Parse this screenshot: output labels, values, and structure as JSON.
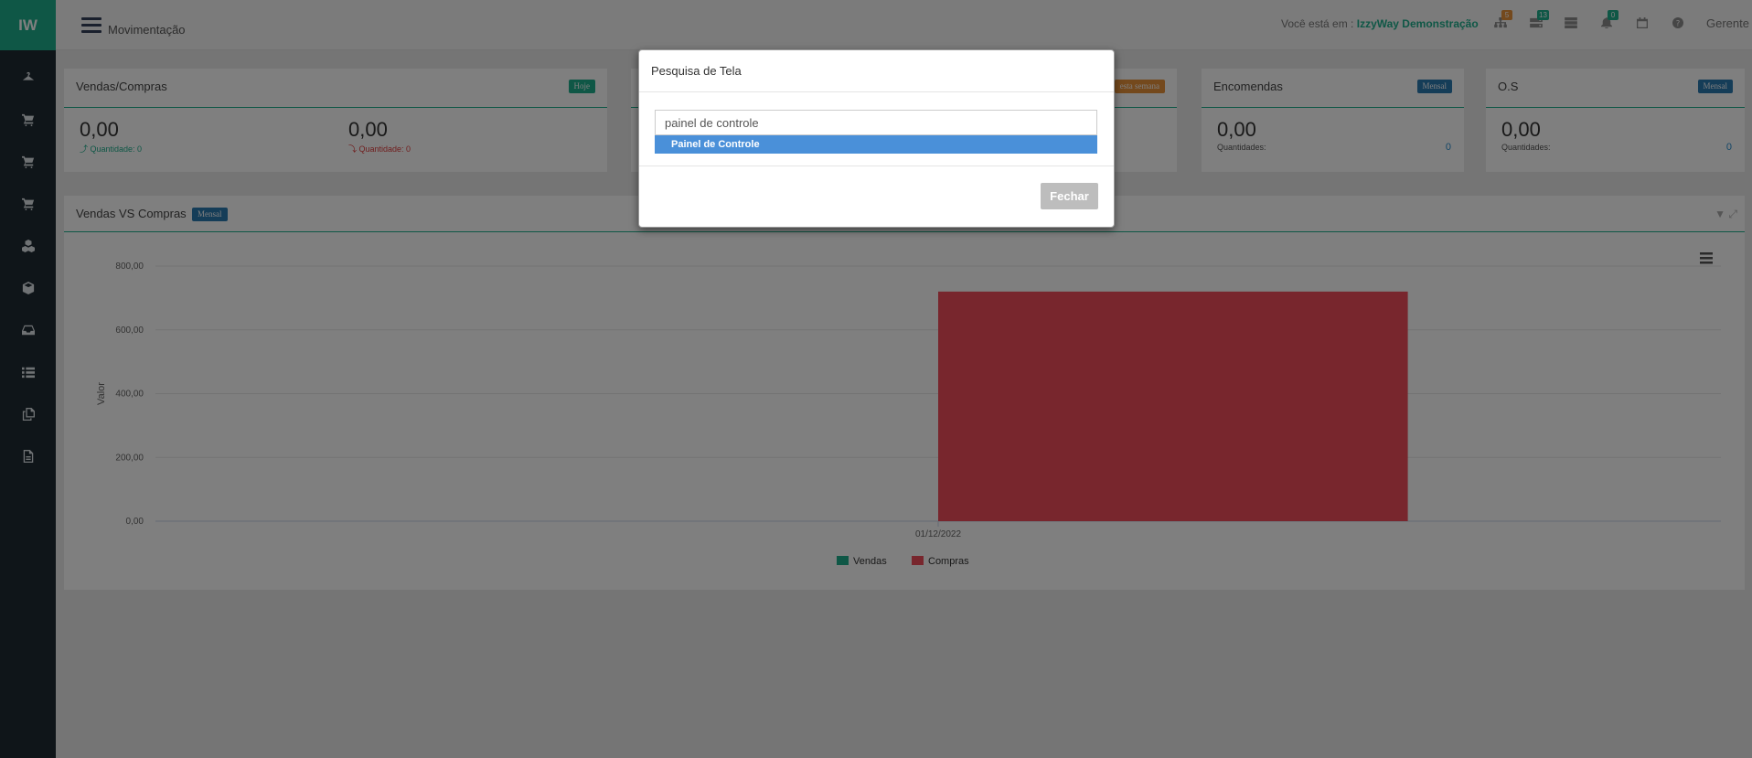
{
  "sidebar": {
    "logo": "IW",
    "items": [
      "hanger-icon",
      "cart-icon",
      "cart-icon",
      "cart-icon",
      "cubes-icon",
      "cube-icon",
      "inbox-icon",
      "list-icon",
      "documents-icon",
      "file-icon"
    ]
  },
  "header": {
    "title": "Movimentação",
    "location_prefix": "Você está em :",
    "location_name": "IzzyWay Demonstração",
    "badges": {
      "sitemap": "5",
      "hdd": "13",
      "bell": "0"
    },
    "user": "Gerente"
  },
  "cards": {
    "vendas_compras": {
      "title": "Vendas/Compras",
      "tag": "Hoje",
      "left_value": "0,00",
      "left_qty": "⤴ Quantidade: 0",
      "right_value": "0,00",
      "right_qty": "⤵ Quantidade: 0"
    },
    "second": {
      "tag": "esta semana"
    },
    "encomendas": {
      "title": "Encomendas",
      "tag": "Mensal",
      "value": "0,00",
      "qty_label": "Quantidades:",
      "qty": "0"
    },
    "os": {
      "title": "O.S",
      "tag": "Mensal",
      "value": "0,00",
      "qty_label": "Quantidades:",
      "qty": "0"
    }
  },
  "panel": {
    "title": "Vendas VS Compras",
    "tag": "Mensal"
  },
  "chart_data": {
    "type": "bar",
    "categories": [
      "01/12/2022"
    ],
    "series": [
      {
        "name": "Vendas",
        "values": [
          0
        ],
        "color": "#1fae8d"
      },
      {
        "name": "Compras",
        "values": [
          720
        ],
        "color": "#f04c5a"
      }
    ],
    "ylabel": "Valor",
    "ylim": [
      0,
      800
    ],
    "yticks": [
      "0,00",
      "200,00",
      "400,00",
      "600,00",
      "800,00"
    ],
    "grid": true,
    "legend": "bottom"
  },
  "modal": {
    "title": "Pesquisa de Tela",
    "search_value": "painel de controle",
    "suggestion": "Painel de Controle",
    "close_label": "Fechar"
  },
  "colors": {
    "brand": "#1fae8d",
    "sidebar": "#1f2a33",
    "tag_green": "#1fae8d",
    "tag_blue": "#2a7ab0",
    "tag_orange": "#e8923a",
    "negative": "#e03c3c"
  }
}
